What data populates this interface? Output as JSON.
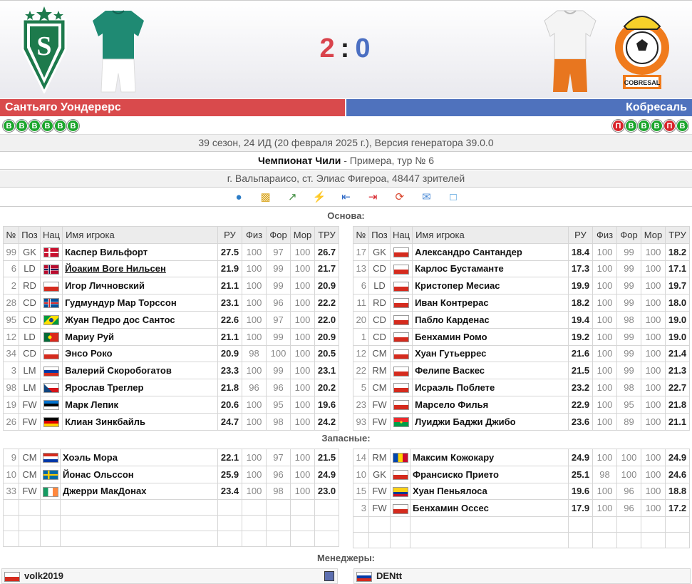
{
  "match": {
    "home_score": "2",
    "away_score": "0",
    "home_team": "Сантьяго Уондерерс",
    "away_team": "Кобресаль",
    "home_form": [
      "В",
      "В",
      "В",
      "В",
      "В",
      "В"
    ],
    "away_form": [
      "П",
      "В",
      "В",
      "В",
      "П",
      "В"
    ],
    "season_line": "39 сезон, 24 ИД (20 февраля 2025 г.), Версия генератора 39.0.0",
    "competition": "Чемпионат Чили",
    "competition_detail": " - Примера, тур № 6",
    "venue": "г. Вальпараисо, ст. Элиас Фигероа, 48447 зрителей",
    "away_logo_text": "COBRESAL",
    "colors": {
      "home": "#d94a4c",
      "away": "#4f72bd",
      "win": "#1aa52b",
      "loss": "#d8232a"
    }
  },
  "toolbar_icons": [
    "players-icon",
    "stats-icon",
    "chart-icon",
    "events-icon",
    "back-arrow-icon",
    "forward-arrow-icon",
    "refresh-icon",
    "comments-icon",
    "monitor-icon"
  ],
  "sections": {
    "starting": "Основа:",
    "subs": "Запасные:",
    "managers": "Менеджеры:"
  },
  "columns": {
    "num": "№",
    "pos": "Поз",
    "nat": "Нац",
    "name": "Имя игрока",
    "ru": "РУ",
    "fiz": "Физ",
    "for": "Фор",
    "mor": "Мор",
    "tru": "ТРУ"
  },
  "home_lineup": [
    {
      "num": "99",
      "pos": "GK",
      "nat": "dk",
      "name": "Каспер Вильфорт",
      "ru": "27.5",
      "fiz": "100",
      "for": "97",
      "mor": "100",
      "tru": "26.7"
    },
    {
      "num": "6",
      "pos": "LD",
      "nat": "no",
      "name": "Йоаким Воге Нильсен",
      "ru": "21.9",
      "fiz": "100",
      "for": "99",
      "mor": "100",
      "tru": "21.7"
    },
    {
      "num": "2",
      "pos": "RD",
      "nat": "cl",
      "name": "Игор Личновский",
      "ru": "21.1",
      "fiz": "100",
      "for": "99",
      "mor": "100",
      "tru": "20.9"
    },
    {
      "num": "28",
      "pos": "CD",
      "nat": "is",
      "name": "Гудмундур Мар Торссон",
      "ru": "23.1",
      "fiz": "100",
      "for": "96",
      "mor": "100",
      "tru": "22.2"
    },
    {
      "num": "95",
      "pos": "CD",
      "nat": "br",
      "name": "Жуан Педро дос Сантос",
      "ru": "22.6",
      "fiz": "100",
      "for": "97",
      "mor": "100",
      "tru": "22.0"
    },
    {
      "num": "12",
      "pos": "LD",
      "nat": "pt",
      "name": "Мариу Руй",
      "ru": "21.1",
      "fiz": "100",
      "for": "99",
      "mor": "100",
      "tru": "20.9"
    },
    {
      "num": "34",
      "pos": "CD",
      "nat": "cl",
      "name": "Энсо Роко",
      "ru": "20.9",
      "fiz": "98",
      "for": "100",
      "mor": "100",
      "tru": "20.5"
    },
    {
      "num": "3",
      "pos": "LM",
      "nat": "ru",
      "name": "Валерий Скоробогатов",
      "ru": "23.3",
      "fiz": "100",
      "for": "99",
      "mor": "100",
      "tru": "23.1"
    },
    {
      "num": "98",
      "pos": "LM",
      "nat": "cz",
      "name": "Ярослав Треглер",
      "ru": "21.8",
      "fiz": "96",
      "for": "96",
      "mor": "100",
      "tru": "20.2"
    },
    {
      "num": "19",
      "pos": "FW",
      "nat": "ee",
      "name": "Марк Лепик",
      "ru": "20.6",
      "fiz": "100",
      "for": "95",
      "mor": "100",
      "tru": "19.6"
    },
    {
      "num": "26",
      "pos": "FW",
      "nat": "de",
      "name": "Клиан Зинкбайль",
      "ru": "24.7",
      "fiz": "100",
      "for": "98",
      "mor": "100",
      "tru": "24.2"
    }
  ],
  "away_lineup": [
    {
      "num": "17",
      "pos": "GK",
      "nat": "cl",
      "name": "Александро Сантандер",
      "ru": "18.4",
      "fiz": "100",
      "for": "99",
      "mor": "100",
      "tru": "18.2"
    },
    {
      "num": "13",
      "pos": "CD",
      "nat": "cl",
      "name": "Карлос Бустаманте",
      "ru": "17.3",
      "fiz": "100",
      "for": "99",
      "mor": "100",
      "tru": "17.1"
    },
    {
      "num": "6",
      "pos": "LD",
      "nat": "cl",
      "name": "Кристопер Месиас",
      "ru": "19.9",
      "fiz": "100",
      "for": "99",
      "mor": "100",
      "tru": "19.7"
    },
    {
      "num": "11",
      "pos": "RD",
      "nat": "cl",
      "name": "Иван Контрерас",
      "ru": "18.2",
      "fiz": "100",
      "for": "99",
      "mor": "100",
      "tru": "18.0"
    },
    {
      "num": "20",
      "pos": "CD",
      "nat": "cl",
      "name": "Пабло Карденас",
      "ru": "19.4",
      "fiz": "100",
      "for": "98",
      "mor": "100",
      "tru": "19.0"
    },
    {
      "num": "1",
      "pos": "CD",
      "nat": "cl",
      "name": "Бенхамин Ромо",
      "ru": "19.2",
      "fiz": "100",
      "for": "99",
      "mor": "100",
      "tru": "19.0"
    },
    {
      "num": "12",
      "pos": "CM",
      "nat": "cl",
      "name": "Хуан Гутьеррес",
      "ru": "21.6",
      "fiz": "100",
      "for": "99",
      "mor": "100",
      "tru": "21.4"
    },
    {
      "num": "22",
      "pos": "RM",
      "nat": "cl",
      "name": "Фелипе Васкес",
      "ru": "21.5",
      "fiz": "100",
      "for": "99",
      "mor": "100",
      "tru": "21.3"
    },
    {
      "num": "5",
      "pos": "CM",
      "nat": "cl",
      "name": "Исраэль Поблете",
      "ru": "23.2",
      "fiz": "100",
      "for": "98",
      "mor": "100",
      "tru": "22.7"
    },
    {
      "num": "23",
      "pos": "FW",
      "nat": "cl",
      "name": "Марсело Филья",
      "ru": "22.9",
      "fiz": "100",
      "for": "95",
      "mor": "100",
      "tru": "21.8"
    },
    {
      "num": "93",
      "pos": "FW",
      "nat": "bf",
      "name": "Луиджи Баджи Джибо",
      "ru": "23.6",
      "fiz": "100",
      "for": "89",
      "mor": "100",
      "tru": "21.1"
    }
  ],
  "home_subs": [
    {
      "num": "9",
      "pos": "CM",
      "nat": "py",
      "name": "Хоэль Мора",
      "ru": "22.1",
      "fiz": "100",
      "for": "97",
      "mor": "100",
      "tru": "21.5"
    },
    {
      "num": "10",
      "pos": "CM",
      "nat": "se",
      "name": "Йонас Ольссон",
      "ru": "25.9",
      "fiz": "100",
      "for": "96",
      "mor": "100",
      "tru": "24.9"
    },
    {
      "num": "33",
      "pos": "FW",
      "nat": "ie",
      "name": "Джерри МакДонах",
      "ru": "23.4",
      "fiz": "100",
      "for": "98",
      "mor": "100",
      "tru": "23.0"
    }
  ],
  "away_subs": [
    {
      "num": "14",
      "pos": "RM",
      "nat": "md",
      "name": "Максим Кожокару",
      "ru": "24.9",
      "fiz": "100",
      "for": "100",
      "mor": "100",
      "tru": "24.9"
    },
    {
      "num": "10",
      "pos": "GK",
      "nat": "cl",
      "name": "Франсиско Прието",
      "ru": "25.1",
      "fiz": "98",
      "for": "100",
      "mor": "100",
      "tru": "24.6"
    },
    {
      "num": "15",
      "pos": "FW",
      "nat": "co",
      "name": "Хуан Пеньялоса",
      "ru": "19.6",
      "fiz": "100",
      "for": "96",
      "mor": "100",
      "tru": "18.8"
    },
    {
      "num": "3",
      "pos": "FW",
      "nat": "cl",
      "name": "Бенхамин Оссес",
      "ru": "17.9",
      "fiz": "100",
      "for": "96",
      "mor": "100",
      "tru": "17.2"
    }
  ],
  "managers": {
    "home": {
      "name": "volk2019",
      "nat": "cl"
    },
    "away": {
      "name": "DENtt",
      "nat": "ru"
    }
  }
}
